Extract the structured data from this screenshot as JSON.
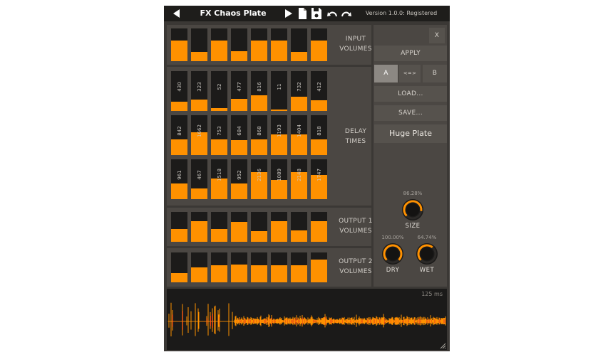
{
  "header": {
    "title": "FX Chaos Plate",
    "version": "Version 1.0.0: Registered"
  },
  "sections": {
    "input_volumes": {
      "line1": "INPUT",
      "line2": "VOLUMES"
    },
    "delay_times": {
      "line1": "DELAY",
      "line2": "TIMES"
    },
    "output1_volumes": {
      "line1": "OUTPUT 1",
      "line2": "VOLUMES"
    },
    "output2_volumes": {
      "line1": "OUTPUT 2",
      "line2": "VOLUMES"
    }
  },
  "faders": {
    "input_levels": [
      0.62,
      0.28,
      0.62,
      0.3,
      0.62,
      0.62,
      0.28,
      0.62
    ],
    "delay_row1": {
      "labels": [
        "430",
        "323",
        "52",
        "477",
        "816",
        "11",
        "732",
        "412"
      ],
      "levels": [
        0.24,
        0.28,
        0.07,
        0.3,
        0.4,
        0.04,
        0.36,
        0.26
      ]
    },
    "delay_row2": {
      "labels": [
        "842",
        "1662",
        "753",
        "684",
        "868",
        "1193",
        "1404",
        "818"
      ],
      "levels": [
        0.4,
        0.58,
        0.4,
        0.38,
        0.4,
        0.52,
        0.52,
        0.4
      ]
    },
    "delay_row3": {
      "labels": [
        "961",
        "467",
        "1518",
        "952",
        "2136",
        "1089",
        "2148",
        "1747"
      ],
      "levels": [
        0.4,
        0.26,
        0.52,
        0.4,
        0.68,
        0.48,
        0.68,
        0.6
      ]
    },
    "output1_levels": [
      0.42,
      0.7,
      0.42,
      0.66,
      0.35,
      0.7,
      0.38,
      0.7
    ],
    "output2_levels": [
      0.3,
      0.5,
      0.56,
      0.6,
      0.56,
      0.56,
      0.56,
      0.76
    ]
  },
  "controls": {
    "close": "X",
    "apply": "APPLY",
    "a": "A",
    "swap": "<=>",
    "b": "B",
    "load": "LOAD...",
    "save": "SAVE...",
    "preset": "Huge Plate"
  },
  "knobs": {
    "size": {
      "label": "SIZE",
      "value": "86.28%",
      "fraction": 0.8628
    },
    "dry": {
      "label": "DRY",
      "value": "100.00%",
      "fraction": 1.0
    },
    "wet": {
      "label": "WET",
      "value": "64.74%",
      "fraction": 0.6474
    }
  },
  "waveform": {
    "time_label": "125 ms"
  },
  "colors": {
    "accent": "#ff9100",
    "panel": "#4b4743",
    "background": "#3b3835",
    "topbar": "#1e1d1b"
  },
  "icons": [
    "prev-arrow-icon",
    "play-arrow-icon",
    "new-file-icon",
    "save-disk-icon",
    "undo-icon",
    "redo-icon",
    "resize-grip-icon"
  ]
}
